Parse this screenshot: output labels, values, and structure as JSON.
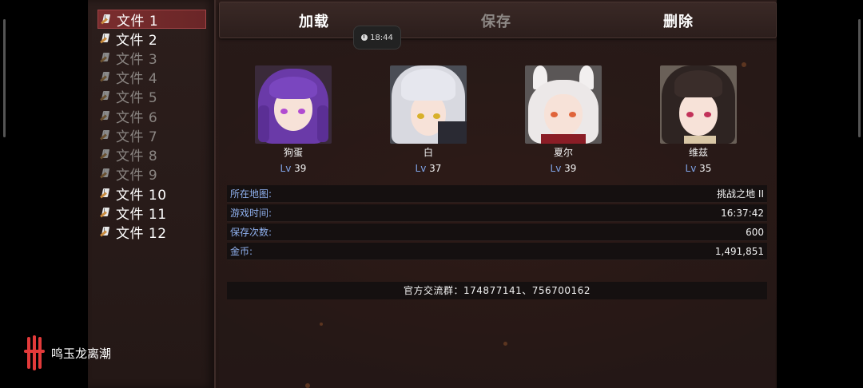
{
  "tabs": {
    "load": "加载",
    "save": "保存",
    "delete": "删除"
  },
  "clock": {
    "time": "18:44"
  },
  "files": [
    {
      "label": "文件 1",
      "filled": true,
      "selected": true
    },
    {
      "label": "文件 2",
      "filled": true
    },
    {
      "label": "文件 3",
      "filled": false
    },
    {
      "label": "文件 4",
      "filled": false
    },
    {
      "label": "文件 5",
      "filled": false
    },
    {
      "label": "文件 6",
      "filled": false
    },
    {
      "label": "文件 7",
      "filled": false
    },
    {
      "label": "文件 8",
      "filled": false
    },
    {
      "label": "文件 9",
      "filled": false
    },
    {
      "label": "文件 10",
      "filled": true
    },
    {
      "label": "文件 11",
      "filled": true
    },
    {
      "label": "文件 12",
      "filled": true
    }
  ],
  "party": [
    {
      "name": "狗蛋",
      "lv_label": "Lv",
      "level": "39"
    },
    {
      "name": "白",
      "lv_label": "Lv",
      "level": "37"
    },
    {
      "name": "夏尔",
      "lv_label": "Lv",
      "level": "39"
    },
    {
      "name": "维兹",
      "lv_label": "Lv",
      "level": "35"
    }
  ],
  "stats": [
    {
      "key": "所在地图:",
      "value": "挑战之地 II"
    },
    {
      "key": "游戏时间:",
      "value": "16:37:42"
    },
    {
      "key": "保存次数:",
      "value": "600"
    },
    {
      "key": "金币:",
      "value": "1,491,851"
    }
  ],
  "group_info": "官方交流群：174877141、756700162",
  "brand": {
    "text": "鸣玉龙离潮"
  },
  "colors": {
    "selected_bg": "#7a2d2e",
    "level_label": "#7fa3e6",
    "stat_key": "#8fb0ee",
    "brand_red": "#e23a3a"
  }
}
